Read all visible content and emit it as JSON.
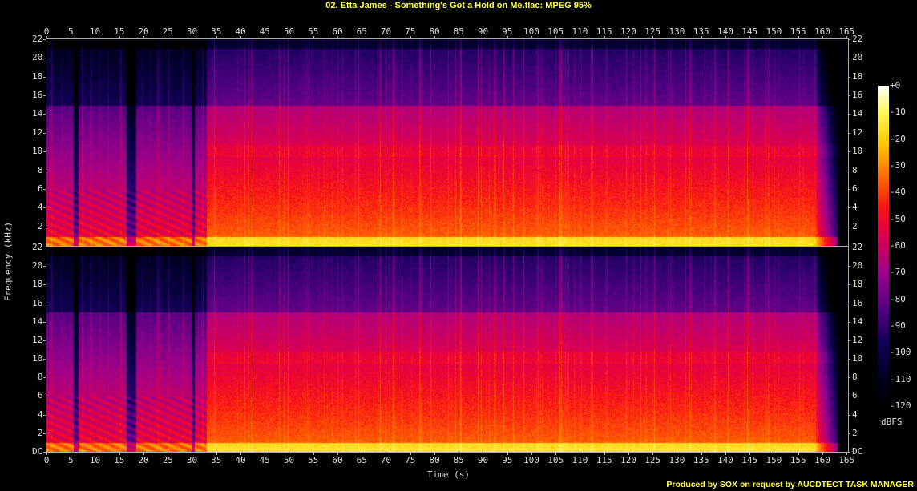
{
  "chart_data": {
    "type": "heatmap",
    "title": "02. Etta James - Something's Got a Hold on Me.flac: MPEG 95%",
    "xlabel": "Time (s)",
    "ylabel": "Frequency (kHz)",
    "xlim": [
      0,
      165.3
    ],
    "ylim": [
      0,
      22
    ],
    "zlim": [
      -120,
      0
    ],
    "channels": 2,
    "x_ticks": [
      "0",
      "5",
      "10",
      "15",
      "20",
      "25",
      "30",
      "35",
      "40",
      "45",
      "50",
      "55",
      "60",
      "65",
      "70",
      "75",
      "80",
      "85",
      "90",
      "95",
      "100",
      "105",
      "110",
      "115",
      "120",
      "125",
      "130",
      "135",
      "140",
      "145",
      "150",
      "155",
      "160",
      "165"
    ],
    "y_ticks": [
      "DC",
      "2",
      "4",
      "6",
      "8",
      "10",
      "12",
      "14",
      "16",
      "18",
      "20",
      "22"
    ],
    "colorbar": {
      "label": "dBFS",
      "ticks": [
        "+0",
        "-10",
        "-20",
        "-30",
        "-40",
        "-50",
        "-60",
        "-70",
        "-80",
        "-90",
        "-100",
        "-110",
        "-120"
      ]
    },
    "description_regions": {
      "quiet_intro_end_s": 33,
      "loud_section": [
        33,
        158
      ],
      "fade_out_end_s": 163,
      "lowpass_shelf_khz": 15
    }
  },
  "footer": "Produced by SOX on request by AUCDTECT TASK MANAGER"
}
